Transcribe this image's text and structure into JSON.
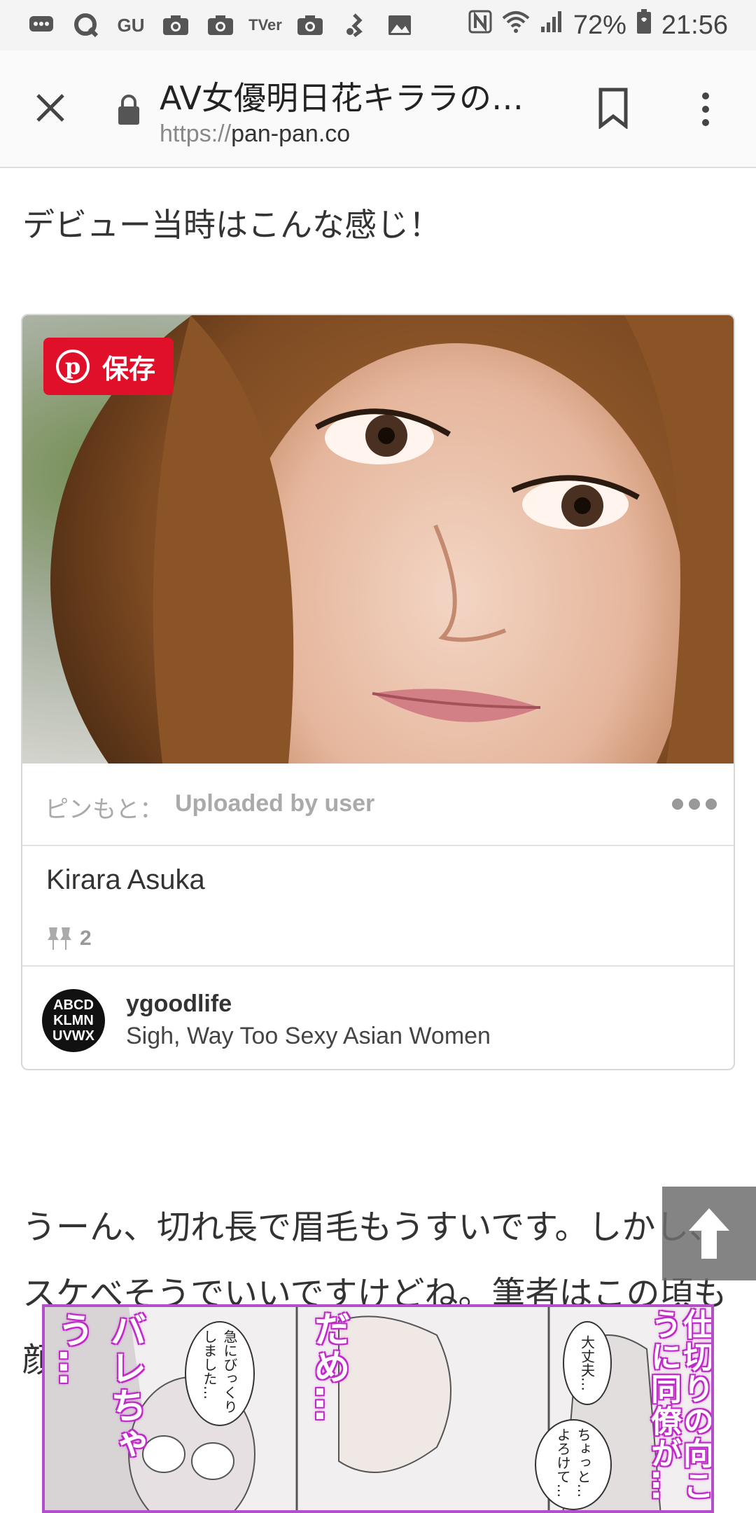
{
  "status_bar": {
    "icons": [
      "chat-icon",
      "q-icon",
      "gu-icon",
      "camera-icon",
      "camera-icon",
      "tver-icon",
      "camera-icon",
      "music-icon",
      "gallery-icon",
      "nfc-icon",
      "wifi-icon",
      "signal-icon",
      "battery-icon"
    ],
    "gu_label": "GU",
    "tver_label": "TVer",
    "battery": "72%",
    "time": "21:56"
  },
  "browser": {
    "title": "AV女優明日花キララの…",
    "url_scheme": "https://",
    "url_host": "pan-pan.co"
  },
  "article": {
    "p1": "デビュー当時はこんな感じ！",
    "p2": "うーん、切れ長で眉毛もうすいです。しかし、スケべそうでいいですけどね。筆者はこの頃も顔…の…"
  },
  "pin": {
    "save_label": "保存",
    "source_label": "ピンもと：",
    "source_value": "Uploaded by user",
    "title": "Kirara Asuka",
    "repin_count": "2",
    "board_user": "ygoodlife",
    "board_name": "Sigh, Way Too Sexy Asian Women",
    "avatar_lines": [
      "ABCD",
      "KLMN",
      "UVWX"
    ]
  },
  "ad": {
    "text_1": "バレちゃう…",
    "text_2": "だめ…",
    "text_3": "仕切りの向こうに同僚が…",
    "bubble_1": "急にびっくりしました…",
    "bubble_2": "大丈夫…",
    "bubble_3": "ちょっと…よろけて…"
  },
  "colors": {
    "pinterest_red": "#e0102a",
    "ad_purple": "#b24fc9"
  }
}
